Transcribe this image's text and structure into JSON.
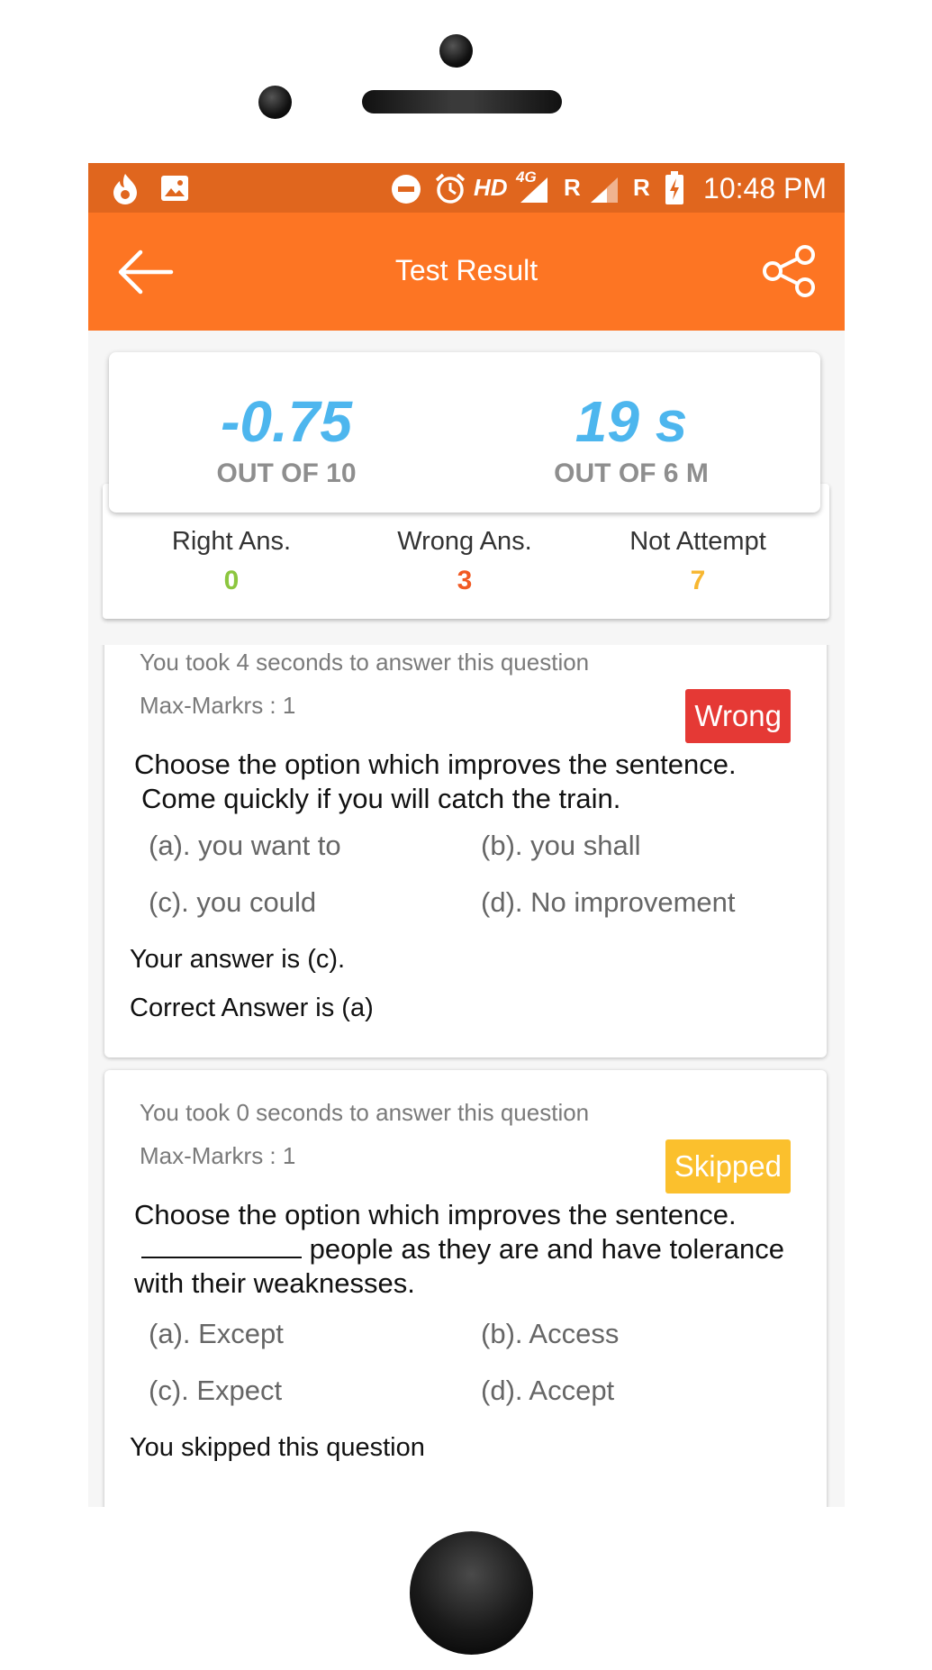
{
  "status_bar": {
    "network": "HD",
    "network_type": "4G",
    "sim1": "R",
    "sim2": "R",
    "time": "10:48 PM"
  },
  "app_bar": {
    "title": "Test Result"
  },
  "score": {
    "marks_value": "-0.75",
    "marks_label": "OUT OF 10",
    "time_value": "19 s",
    "time_label": "OUT OF 6 M"
  },
  "stats": [
    {
      "label": "Right Ans.",
      "value": "0",
      "color": "#8cc63f"
    },
    {
      "label": "Wrong Ans.",
      "value": "3",
      "color": "#f15a24"
    },
    {
      "label": "Not Attempt",
      "value": "7",
      "color": "#f7b731"
    }
  ],
  "questions": [
    {
      "time_text": "You took 4 seconds to answer this question",
      "max_marks": "Max-Markrs : 1",
      "status": "Wrong",
      "status_color": "#e53935",
      "question_line1": "Choose the option which improves the sentence.",
      "question_line2": "Come quickly if you will catch the train.",
      "options": [
        "(a).  you want to",
        "(b).  you shall",
        "(c).  you could",
        "(d).  No improvement"
      ],
      "your_answer": "Your answer is (c).",
      "correct_answer": "Correct Answer is (a)"
    },
    {
      "time_text": "You took 0 seconds to answer this question",
      "max_marks": "Max-Markrs : 1",
      "status": "Skipped",
      "status_color": "#fbc02d",
      "question_line1": "Choose the option which improves the sentence.",
      "question_line2": "people as they are and have tolerance",
      "question_line3": "with their weaknesses.",
      "options": [
        "(a).  Except",
        "(b).  Access",
        "(c).  Expect",
        "(d).  Accept"
      ],
      "your_answer": "You skipped this question"
    }
  ]
}
